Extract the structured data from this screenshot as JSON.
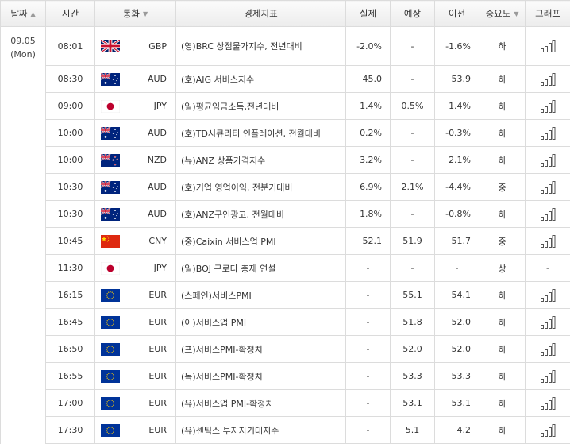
{
  "header": {
    "date": "날짜",
    "time": "시간",
    "currency": "통화",
    "indicator": "경제지표",
    "actual": "실제",
    "forecast": "예상",
    "previous": "이전",
    "importance": "중요도",
    "graph": "그래프"
  },
  "date_cell": {
    "date": "09.05",
    "weekday": "(Mon)"
  },
  "rows": [
    {
      "time": "08:01",
      "flag": "uk-flag-icon",
      "currency": "GBP",
      "indicator": "(영)BRC 상점물가지수, 전년대비",
      "actual": "-2.0%",
      "forecast": "-",
      "previous": "-1.6%",
      "importance": "하",
      "graph": true
    },
    {
      "time": "08:30",
      "flag": "australia-flag-icon",
      "currency": "AUD",
      "indicator": "(호)AIG 서비스지수",
      "actual": "45.0",
      "forecast": "-",
      "previous": "53.9",
      "importance": "하",
      "graph": true
    },
    {
      "time": "09:00",
      "flag": "japan-flag-icon",
      "currency": "JPY",
      "indicator": "(일)평균임금소득,전년대비",
      "actual": "1.4%",
      "forecast": "0.5%",
      "previous": "1.4%",
      "importance": "하",
      "graph": true
    },
    {
      "time": "10:00",
      "flag": "australia-flag-icon",
      "currency": "AUD",
      "indicator": "(호)TD시큐리티 인플레이션, 전월대비",
      "actual": "0.2%",
      "forecast": "-",
      "previous": "-0.3%",
      "importance": "하",
      "graph": true
    },
    {
      "time": "10:00",
      "flag": "new-zealand-flag-icon",
      "currency": "NZD",
      "indicator": "(뉴)ANZ 상품가격지수",
      "actual": "3.2%",
      "forecast": "-",
      "previous": "2.1%",
      "importance": "하",
      "graph": true
    },
    {
      "time": "10:30",
      "flag": "australia-flag-icon",
      "currency": "AUD",
      "indicator": "(호)기업 영업이익, 전분기대비",
      "actual": "6.9%",
      "forecast": "2.1%",
      "previous": "-4.4%",
      "importance": "중",
      "graph": true
    },
    {
      "time": "10:30",
      "flag": "australia-flag-icon",
      "currency": "AUD",
      "indicator": "(호)ANZ구인광고, 전월대비",
      "actual": "1.8%",
      "forecast": "-",
      "previous": "-0.8%",
      "importance": "하",
      "graph": true
    },
    {
      "time": "10:45",
      "flag": "china-flag-icon",
      "currency": "CNY",
      "indicator": "(중)Caixin 서비스업 PMI",
      "actual": "52.1",
      "forecast": "51.9",
      "previous": "51.7",
      "importance": "중",
      "graph": true
    },
    {
      "time": "11:30",
      "flag": "japan-flag-icon",
      "currency": "JPY",
      "indicator": "(일)BOJ 구로다 총재 연설",
      "actual": "-",
      "forecast": "-",
      "previous": "-",
      "importance": "상",
      "graph": false,
      "graph_text": "-"
    },
    {
      "time": "16:15",
      "flag": "eu-flag-icon",
      "currency": "EUR",
      "indicator": "(스페인)서비스PMI",
      "actual": "-",
      "forecast": "55.1",
      "previous": "54.1",
      "importance": "하",
      "graph": true
    },
    {
      "time": "16:45",
      "flag": "eu-flag-icon",
      "currency": "EUR",
      "indicator": "(이)서비스업 PMI",
      "actual": "-",
      "forecast": "51.8",
      "previous": "52.0",
      "importance": "하",
      "graph": true
    },
    {
      "time": "16:50",
      "flag": "eu-flag-icon",
      "currency": "EUR",
      "indicator": "(프)서비스PMI-확정치",
      "actual": "-",
      "forecast": "52.0",
      "previous": "52.0",
      "importance": "하",
      "graph": true
    },
    {
      "time": "16:55",
      "flag": "eu-flag-icon",
      "currency": "EUR",
      "indicator": "(독)서비스PMI-확정치",
      "actual": "-",
      "forecast": "53.3",
      "previous": "53.3",
      "importance": "하",
      "graph": true
    },
    {
      "time": "17:00",
      "flag": "eu-flag-icon",
      "currency": "EUR",
      "indicator": "(유)서비스업 PMI-확정치",
      "actual": "-",
      "forecast": "53.1",
      "previous": "53.1",
      "importance": "하",
      "graph": true
    },
    {
      "time": "17:30",
      "flag": "eu-flag-icon",
      "currency": "EUR",
      "indicator": "(유)센틱스 투자자기대지수",
      "actual": "-",
      "forecast": "5.1",
      "previous": "4.2",
      "importance": "하",
      "graph": true
    }
  ]
}
